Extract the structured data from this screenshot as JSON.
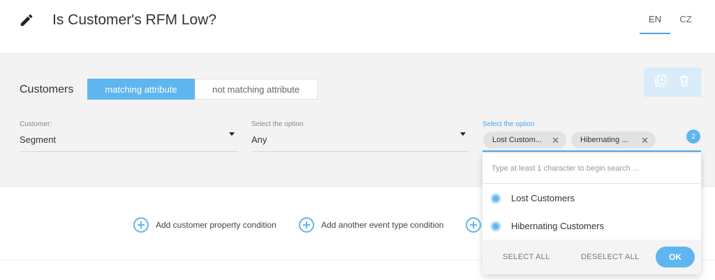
{
  "header": {
    "title": "Is Customer's RFM Low?",
    "languages": [
      {
        "code": "EN",
        "active": true
      },
      {
        "code": "CZ",
        "active": false
      }
    ]
  },
  "filter": {
    "customers_label": "Customers",
    "toggle": {
      "active": "matching attribute",
      "inactive": "not matching attribute"
    },
    "fields": [
      {
        "label": "Customer:",
        "value": "Segment"
      },
      {
        "label": "Select the option",
        "value": "Any"
      },
      {
        "label": "Select the option",
        "chips": [
          "Lost Custom...",
          "Hibernating ..."
        ],
        "count": "2"
      }
    ]
  },
  "dropdown": {
    "search_placeholder": "Type at least 1 character to begin search ...",
    "options": [
      "Lost Customers",
      "Hibernating Customers"
    ],
    "select_all": "SELECT ALL",
    "deselect_all": "DESELECT ALL",
    "ok": "OK"
  },
  "conditions": [
    "Add customer property condition",
    "Add another event type condition"
  ],
  "colors": {
    "accent": "#5eb5f0",
    "panel_bg": "#f3f3f3",
    "action_box_bg": "#d9ecfa"
  }
}
